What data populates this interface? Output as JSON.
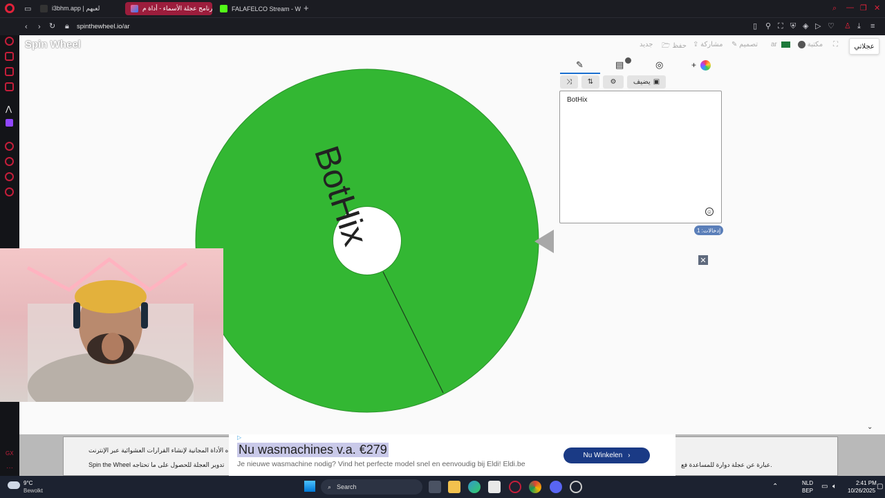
{
  "browser": {
    "tabs": [
      {
        "label": "i3bhm.app | لعبهم",
        "color": "#202124"
      },
      {
        "label": "برنامج عجلة الأسماء - أداة م...",
        "color": "#9c1d3c"
      },
      {
        "label": "FALAFELCO Stream - Wat",
        "color": "#202124"
      }
    ],
    "url": "spinthewheel.io/ar"
  },
  "site": {
    "logo": "Spin Wheel",
    "nav": {
      "new": "جديد",
      "save": "حفظ",
      "share": "مشاركة",
      "customize": "تصميم",
      "lang": "ar",
      "gallery": "مكتبة"
    },
    "my_wheels": "عجلاتي"
  },
  "wheel": {
    "entry_label": "BotHix",
    "color": "#33b733"
  },
  "panel": {
    "add_image_label": "يضيف",
    "entries_text": "BotHix",
    "entries_count": "إدخالات: 1"
  },
  "ad": {
    "title": "Nu wasmachines v.a. €279",
    "description": "Je nieuwe wasmachine nodig? Vind het perfecte model snel en eenvoudig bij Eldi! Eldi.be",
    "cta": "Nu Winkelen",
    "bg_text_1": "ه الأداة المجانية لإنشاء القرارات العشوائية عبر الإنترنت",
    "bg_text_2": "Spin the Wheel تدوير العجلة للحصول على ما تحتاجه",
    "bg_text_3": "عبارة عن عجلة دوارة للمساعدة فع."
  },
  "taskbar": {
    "weather_temp": "9°C",
    "weather_desc": "Bewolkt",
    "search_placeholder": "Search",
    "lang_1": "NLD",
    "lang_2": "BEP",
    "time": "2:41 PM",
    "date": "10/26/2025"
  }
}
